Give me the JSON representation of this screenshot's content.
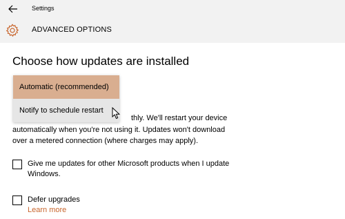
{
  "window": {
    "title": "Settings",
    "back_icon": "arrow-left-icon"
  },
  "header": {
    "icon": "gear-icon",
    "title": "ADVANCED OPTIONS"
  },
  "main": {
    "heading": "Choose how updates are installed",
    "dropdown": {
      "options": [
        {
          "label": "Automatic (recommended)",
          "selected": true
        },
        {
          "label": "Notify to schedule restart",
          "selected": false
        }
      ]
    },
    "description": {
      "line1_visible": "thly. We'll restart your device",
      "line2": "automatically when you're not using it. Updates won't download",
      "line3": "over a metered connection (where charges may apply)."
    },
    "checkboxes": [
      {
        "label": "Give me updates for other Microsoft products when I update Windows.",
        "checked": false
      },
      {
        "label": "Defer upgrades",
        "checked": false
      }
    ],
    "learn_more": "Learn more"
  },
  "colors": {
    "accent": "#c8652c",
    "selected_option": "#d9ae90",
    "option_background": "#e6e6e6"
  }
}
